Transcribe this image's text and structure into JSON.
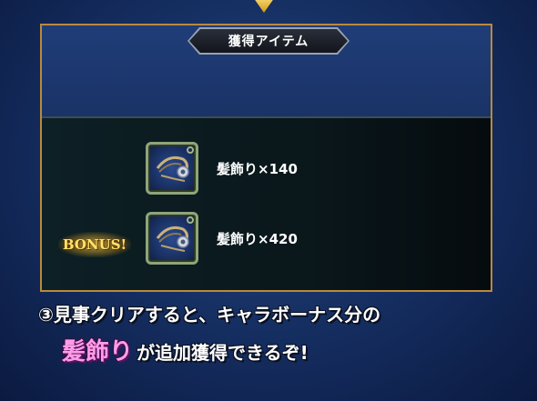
{
  "header": {
    "title": "獲得アイテム"
  },
  "items": [
    {
      "name": "髪飾り",
      "quantity_text": "×140",
      "icon": "hair-ornament-icon",
      "bonus": false
    },
    {
      "name": "髪飾り",
      "quantity_text": "×420",
      "icon": "hair-ornament-icon",
      "bonus": true
    }
  ],
  "bonus_label": "BONUS!",
  "caption": {
    "line1": "③見事クリアすると、キャラボーナス分の",
    "highlight": "髪飾り",
    "line2_rest": "が追加獲得できるぞ!"
  },
  "colors": {
    "panel_border": "#b98a3d",
    "highlight": "#ff9de6",
    "bonus": "#ffe36a"
  }
}
